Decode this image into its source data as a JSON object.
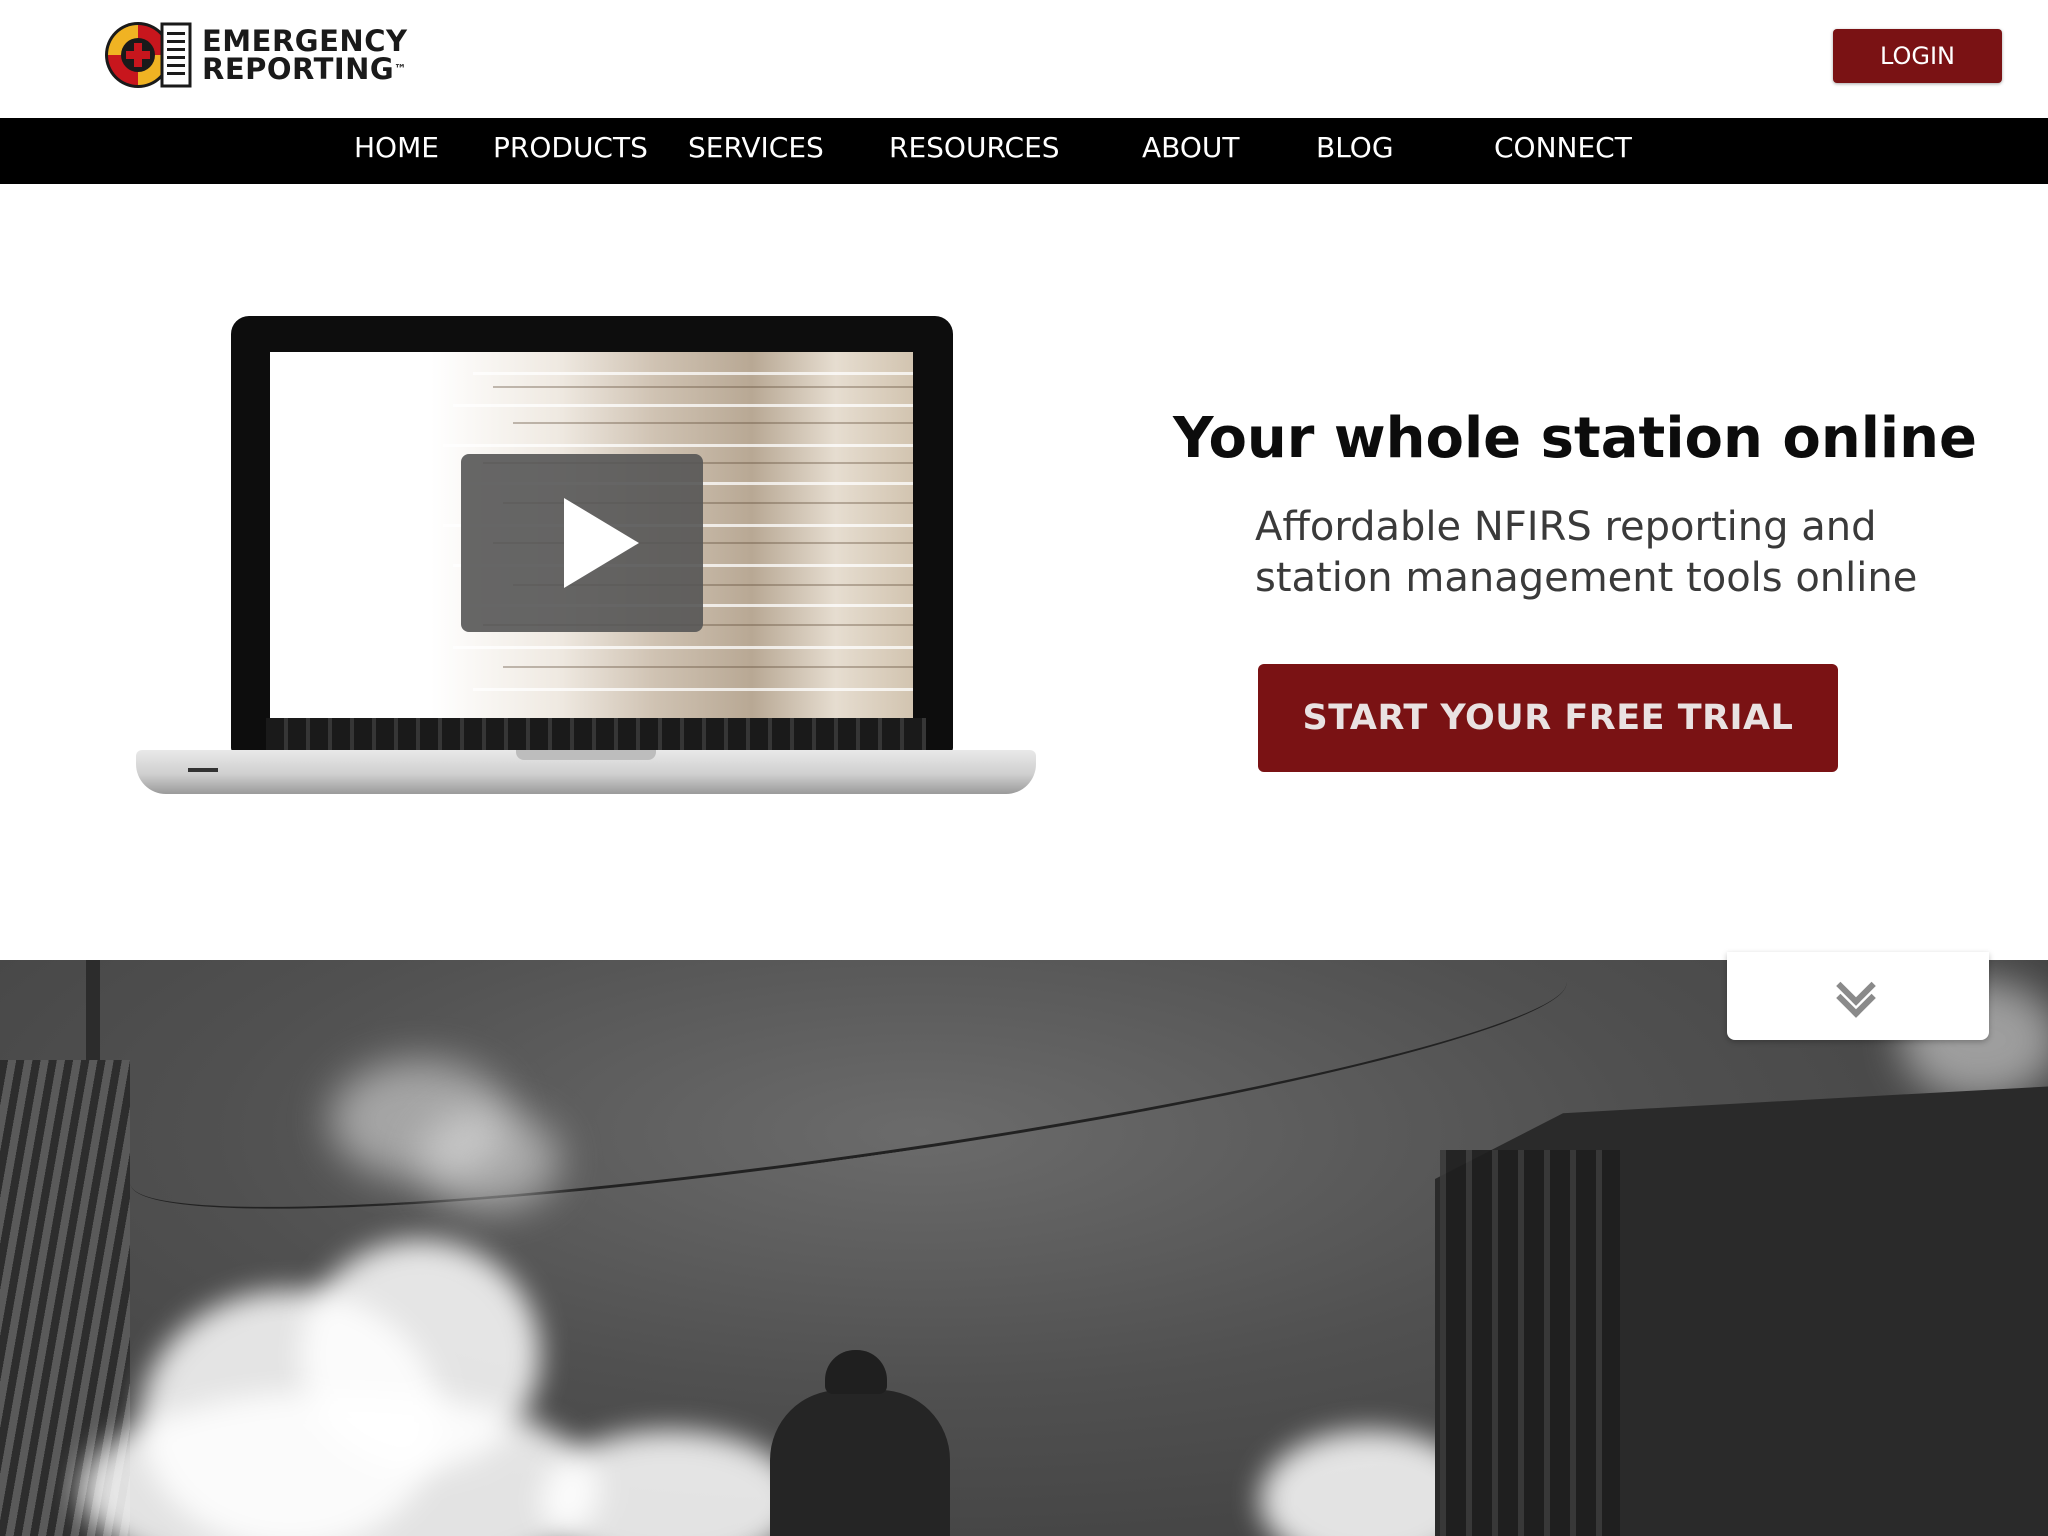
{
  "header": {
    "logo_line1": "EMERGENCY",
    "logo_line2": "REPORTING",
    "logo_tm": "™",
    "login_label": "LOGIN"
  },
  "nav": {
    "items": [
      {
        "label": "HOME"
      },
      {
        "label": "PRODUCTS"
      },
      {
        "label": "SERVICES"
      },
      {
        "label": "RESOURCES"
      },
      {
        "label": "ABOUT"
      },
      {
        "label": "BLOG"
      },
      {
        "label": "CONNECT"
      }
    ]
  },
  "hero": {
    "title": "Your whole station online",
    "subtitle_line1": "Affordable NFIRS reporting and",
    "subtitle_line2": "station management tools online",
    "cta_label": "START YOUR FREE TRIAL",
    "video_icon": "play-icon"
  },
  "scroll": {
    "icon": "double-chevron-down-icon"
  },
  "colors": {
    "brand_red": "#7a1214",
    "nav_bg": "#000000",
    "logo_red": "#c8161d",
    "logo_yellow": "#f0b323"
  }
}
